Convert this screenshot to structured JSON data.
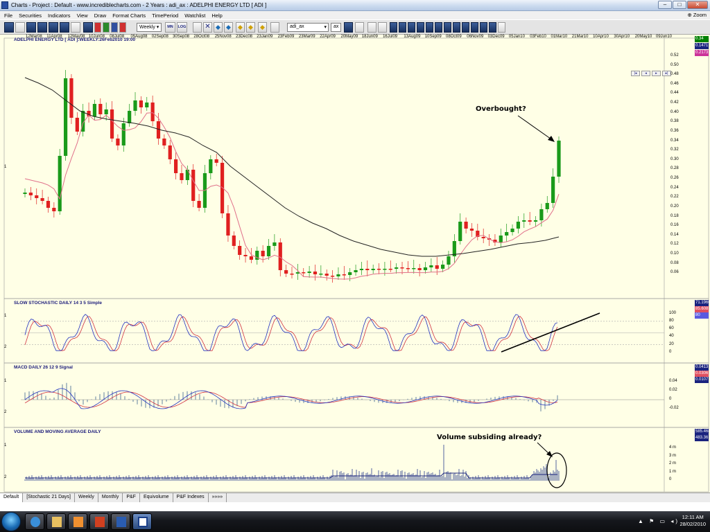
{
  "window": {
    "title": "Charts - Project : Default - www.incrediblecharts.com - 2 Years  : adi_ax : ADELPHI ENERGY LTD  [ ADI ]",
    "min": "–",
    "max": "□",
    "close": "✕"
  },
  "menu": {
    "items": [
      "File",
      "Securities",
      "Indicators",
      "View",
      "Draw",
      "Format Charts",
      "TimePeriod",
      "Watchlist",
      "Help"
    ],
    "zoom": "Zoom"
  },
  "toolbar": {
    "period": "Weekly",
    "security": "adi_ax",
    "exchange": "ax",
    "btn_mn": "MN",
    "btn_log": "LOG"
  },
  "price_panel": {
    "title": "ADELPHI ENERGY LTD  [ ADI ]:WEEKLY:26Feb2010 19:00",
    "marker": "1",
    "last_price": "0.34",
    "ma_fast": "0.1471",
    "ma_slow": "0.2173",
    "colors": {
      "up": "#1a9a1a",
      "down": "#e02020",
      "ma_fast": "#e0708a",
      "ma_slow": "#222222",
      "last": "#008000",
      "ma1": "#1a237e",
      "ma2": "#cc3399"
    },
    "ticks": [
      "0.52",
      "0.50",
      "0.48",
      "0.46",
      "0.44",
      "0.42",
      "0.40",
      "0.38",
      "0.36",
      "0.34",
      "0.32",
      "0.30",
      "0.28",
      "0.26",
      "0.24",
      "0.22",
      "0.20",
      "0.18",
      "0.16",
      "0.14",
      "0.12",
      "0.10",
      "0.08",
      "0.06"
    ],
    "dates": [
      "12Mar08",
      "11Apr08",
      "12May08",
      "10Jun08",
      "08Jul08",
      "05Aug08",
      "02Sep08",
      "30Sep08",
      "28Oct08",
      "25Nov08",
      "23Dec08",
      "23Jan09",
      "23Feb09",
      "23Mar09",
      "22Apr09",
      "20May09",
      "18Jun09",
      "16Jul09",
      "13Aug09",
      "10Sep09",
      "08Oct09",
      "06Nov09",
      "03Dec09",
      "05Jan10",
      "03Feb10",
      "01Mar10",
      "21Mar10",
      "10Apr10",
      "30Apr10",
      "20May10",
      "09Jun10"
    ],
    "annotation": "Overbought?"
  },
  "stoch_panel": {
    "title": "SLOW STOCHASTIC DAILY 14 3 5 Simple",
    "marker_top": "1",
    "marker_bottom": "2",
    "value1": "71.1966",
    "value2": "85.608",
    "value3": "80",
    "colors": {
      "k": "#2030c0",
      "d": "#d03040",
      "box1": "#1a237e",
      "box2": "#e05060",
      "box3": "#5a5ae0"
    },
    "ticks": [
      "100",
      "80",
      "60",
      "40",
      "20",
      "0"
    ]
  },
  "macd_panel": {
    "title": "MACD DAILY 26 12 9 Signal",
    "marker_top": "1",
    "marker_bottom": "2",
    "value1": "0.0413",
    "value2": "0.0306",
    "value3": "0.0107",
    "colors": {
      "macd": "#2030c0",
      "signal": "#d03040",
      "hist": "#6080a0",
      "box1": "#1a237e",
      "box2": "#e05060",
      "box3": "#1a237e"
    },
    "ticks": [
      "0.04",
      "0.02",
      "0",
      "-0.02"
    ]
  },
  "volume_panel": {
    "title": "VOLUME AND MOVING AVERAGE DAILY",
    "marker_top": "1",
    "marker_bottom": "2",
    "value1": "585.4643 th",
    "value2": "483.36 th",
    "colors": {
      "bar": "#2a3f8f",
      "ma": "#1a237e",
      "box1": "#1a237e",
      "box2": "#1a237e"
    },
    "ticks": [
      "4 m",
      "3 m",
      "2 m",
      "1 m",
      "0"
    ],
    "annotation": "Volume subsiding already?"
  },
  "tabs": [
    "Default",
    "[Stochastic 21 Days]",
    "Weekly",
    "Monthly",
    "P&F",
    "Equivolume",
    "P&F Indexes",
    "»»»»"
  ],
  "taskbar": {
    "time": "12:11 AM",
    "date": "28/02/2010",
    "tray": "▲ ⚑ ▭ ◂)"
  }
}
